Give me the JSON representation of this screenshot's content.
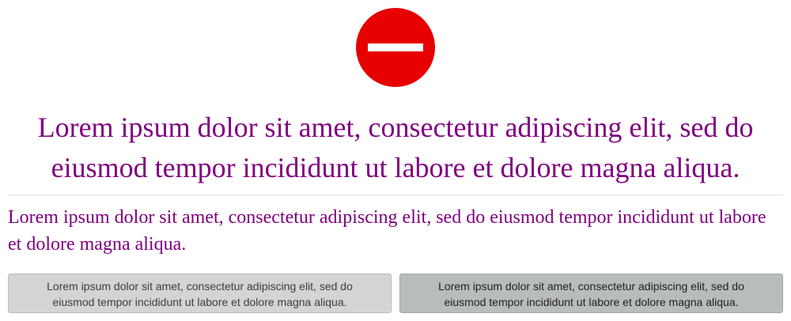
{
  "icon": {
    "name": "no-entry-icon",
    "color": "#e60000",
    "bar_color": "#ffffff"
  },
  "heading": {
    "text": "Lorem ipsum dolor sit amet, consectetur adipiscing elit, sed do eiusmod tempor incididunt ut labore et dolore magna aliqua.",
    "color": "#800080"
  },
  "paragraph": {
    "text": "Lorem ipsum dolor sit amet, consectetur adipiscing elit, sed do eiusmod tempor incididunt ut labore et dolore magna aliqua."
  },
  "buttons": [
    {
      "label": "Lorem ipsum dolor sit amet, consectetur adipiscing elit, sed do eiusmod tempor incididunt ut labore et dolore magna aliqua."
    },
    {
      "label": "Lorem ipsum dolor sit amet, consectetur adipiscing elit, sed do eiusmod tempor incididunt ut labore et dolore magna aliqua."
    }
  ]
}
